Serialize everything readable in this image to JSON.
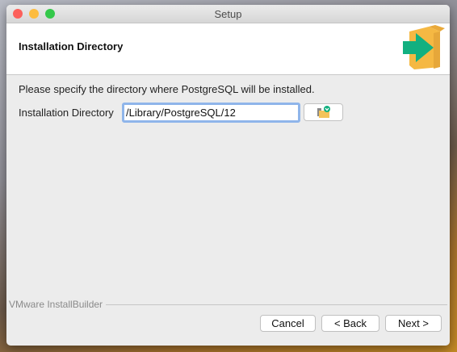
{
  "window": {
    "title": "Setup"
  },
  "header": {
    "title": "Installation Directory"
  },
  "body": {
    "description": "Please specify the directory where PostgreSQL will be installed.",
    "directory_label": "Installation Directory",
    "directory_value": "/Library/PostgreSQL/12"
  },
  "footer": {
    "brand": "VMware InstallBuilder",
    "cancel": "Cancel",
    "back": "< Back",
    "next": "Next >"
  },
  "colors": {
    "close": "#fc605b",
    "minimize": "#fdbc40",
    "maximize": "#34c84a",
    "arrow": "#12b080",
    "box": "#f5b843"
  }
}
